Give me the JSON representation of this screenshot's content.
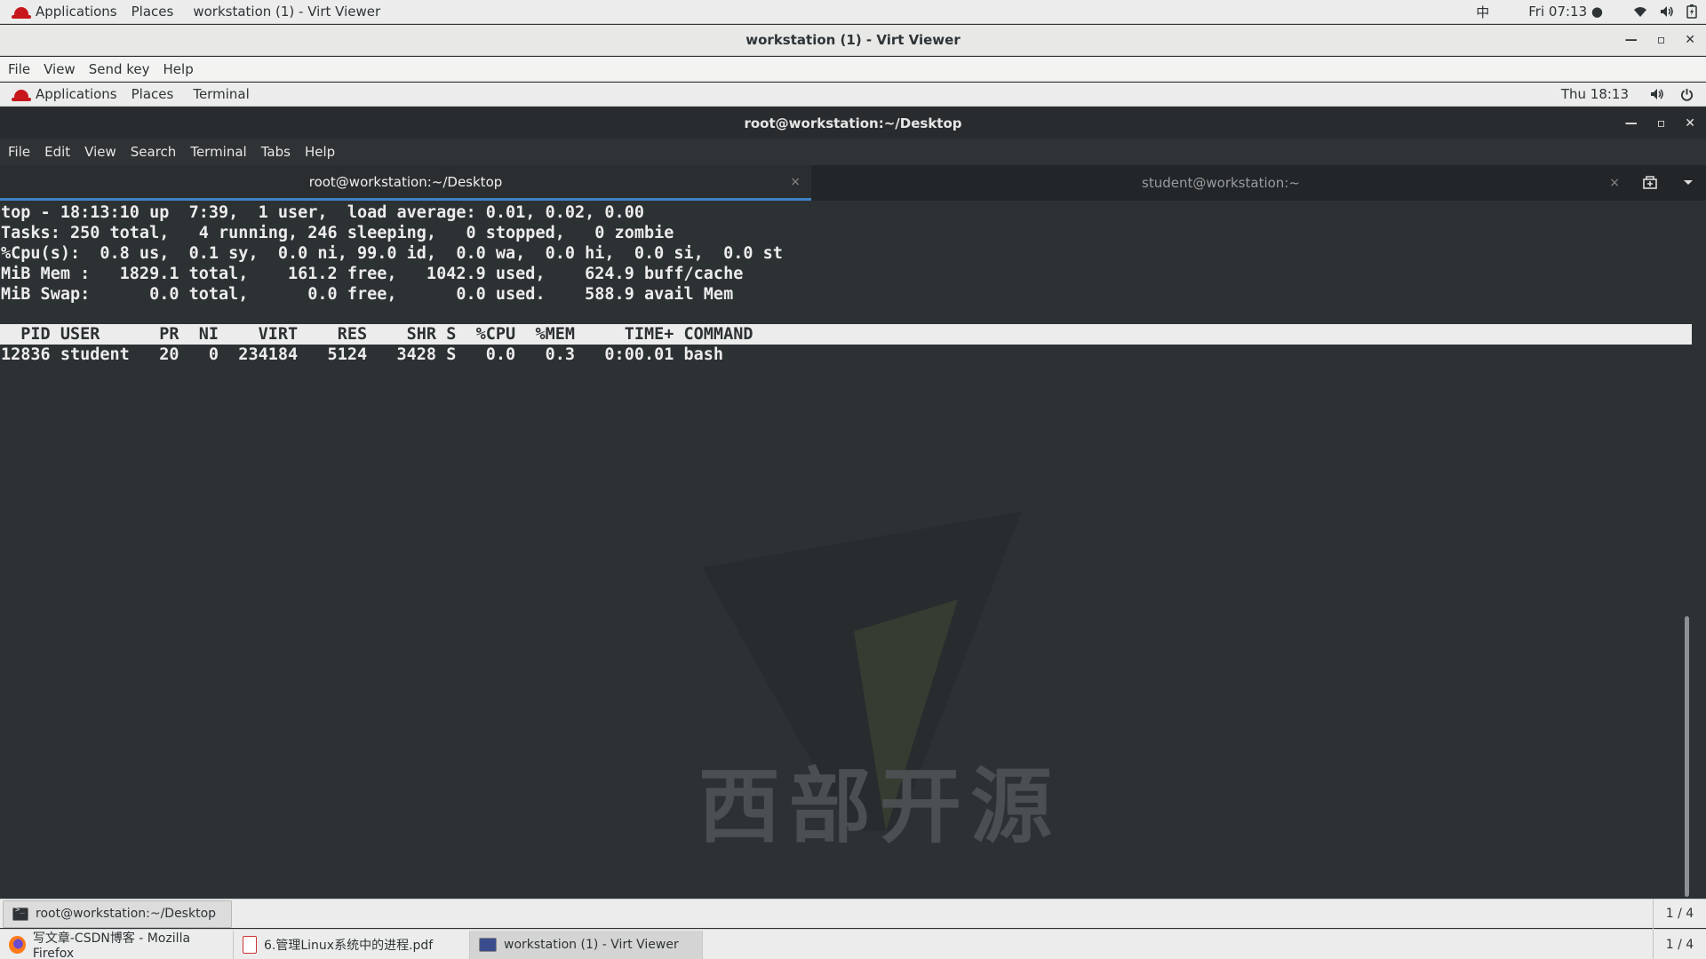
{
  "host_top": {
    "applications": "Applications",
    "places": "Places",
    "active_window": "workstation (1) - Virt Viewer",
    "input_method": "中",
    "clock": "Fri 07:13 ●"
  },
  "virt_viewer": {
    "title": "workstation (1) - Virt Viewer",
    "menu": [
      "File",
      "View",
      "Send key",
      "Help"
    ]
  },
  "guest_top": {
    "applications": "Applications",
    "places": "Places",
    "terminal": "Terminal",
    "clock": "Thu 18:13"
  },
  "terminal": {
    "title": "root@workstation:~/Desktop",
    "menu": [
      "File",
      "Edit",
      "View",
      "Search",
      "Terminal",
      "Tabs",
      "Help"
    ],
    "tabs": [
      {
        "label": "root@workstation:~/Desktop",
        "close": "×"
      },
      {
        "label": "student@workstation:~",
        "close": "×"
      }
    ],
    "lines": [
      "top - 18:13:10 up  7:39,  1 user,  load average: 0.01, 0.02, 0.00",
      "Tasks: 250 total,   4 running, 246 sleeping,   0 stopped,   0 zombie",
      "%Cpu(s):  0.8 us,  0.1 sy,  0.0 ni, 99.0 id,  0.0 wa,  0.0 hi,  0.0 si,  0.0 st",
      "MiB Mem :   1829.1 total,    161.2 free,   1042.9 used,    624.9 buff/cache",
      "MiB Swap:      0.0 total,      0.0 free,      0.0 used.    588.9 avail Mem"
    ],
    "header": "  PID USER      PR  NI    VIRT    RES    SHR S  %CPU  %MEM     TIME+ COMMAND",
    "process_row": "12836 student   20   0  234184   5124   3428 S   0.0   0.3   0:00.01 bash"
  },
  "watermark": {
    "text": "西部开源"
  },
  "guest_taskbar": {
    "item": "root@workstation:~/Desktop",
    "pager": "1 / 4"
  },
  "host_taskbar": {
    "items": [
      "写文章-CSDN博客 - Mozilla Firefox",
      "6.管理Linux系统中的进程.pdf",
      "workstation (1) - Virt Viewer"
    ],
    "pager": "1 / 4"
  }
}
